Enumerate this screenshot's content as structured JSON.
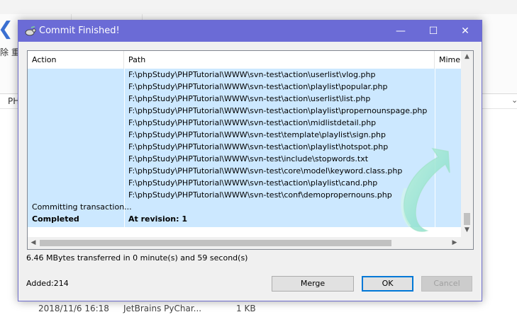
{
  "background": {
    "address_text": "PH",
    "side_labels": [
      "除",
      "重"
    ],
    "file_row": {
      "date": "2018/11/6 16:18",
      "app": "JetBrains PyChar...",
      "size": "1 KB"
    }
  },
  "dialog": {
    "title": "Commit Finished!",
    "controls": {
      "minimize": "—",
      "maximize": "☐",
      "close": "✕"
    },
    "columns": [
      "Action",
      "Path",
      "Mime t"
    ],
    "rows": [
      {
        "action": "",
        "path": "F:\\phpStudy\\PHPTutorial\\WWW\\svn-test\\action\\userlist\\vlog.php"
      },
      {
        "action": "",
        "path": "F:\\phpStudy\\PHPTutorial\\WWW\\svn-test\\action\\playlist\\popular.php"
      },
      {
        "action": "",
        "path": "F:\\phpStudy\\PHPTutorial\\WWW\\svn-test\\action\\userlist\\list.php"
      },
      {
        "action": "",
        "path": "F:\\phpStudy\\PHPTutorial\\WWW\\svn-test\\action\\playlist\\propernounspage.php"
      },
      {
        "action": "",
        "path": "F:\\phpStudy\\PHPTutorial\\WWW\\svn-test\\action\\midlistdetail.php"
      },
      {
        "action": "",
        "path": "F:\\phpStudy\\PHPTutorial\\WWW\\svn-test\\template\\playlist\\sign.php"
      },
      {
        "action": "",
        "path": "F:\\phpStudy\\PHPTutorial\\WWW\\svn-test\\action\\playlist\\hotspot.php"
      },
      {
        "action": "",
        "path": "F:\\phpStudy\\PHPTutorial\\WWW\\svn-test\\include\\stopwords.txt"
      },
      {
        "action": "",
        "path": "F:\\phpStudy\\PHPTutorial\\WWW\\svn-test\\core\\model\\keyword.class.php"
      },
      {
        "action": "",
        "path": "F:\\phpStudy\\PHPTutorial\\WWW\\svn-test\\action\\playlist\\cand.php"
      },
      {
        "action": "",
        "path": "F:\\phpStudy\\PHPTutorial\\WWW\\svn-test\\conf\\demopropernouns.php"
      },
      {
        "action": "Committing transaction...",
        "path": ""
      },
      {
        "action": "Completed",
        "path": "At revision: 1",
        "bold": true
      }
    ],
    "status_text": "6.46 MBytes transferred in 0 minute(s) and 59 second(s)",
    "added_text": "Added:214",
    "buttons": {
      "merge": "Merge",
      "ok": "OK",
      "cancel": "Cancel"
    },
    "colors": {
      "titlebar": "#6b6bd6",
      "selection": "#cce8ff",
      "accent": "#0078d7"
    }
  }
}
